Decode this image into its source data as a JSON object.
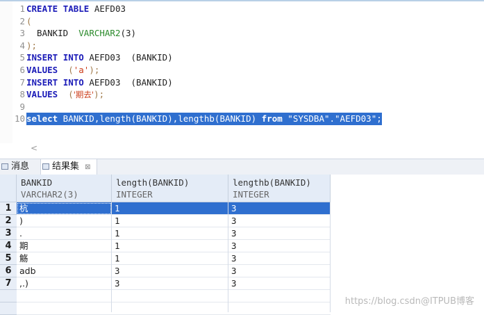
{
  "editor": {
    "lines": [
      {
        "n": "1",
        "tokens": [
          {
            "t": "CREATE",
            "c": "kw"
          },
          {
            "t": " ",
            "c": "id"
          },
          {
            "t": "TABLE",
            "c": "kw"
          },
          {
            "t": " AEFD03",
            "c": "id"
          }
        ]
      },
      {
        "n": "2",
        "tokens": [
          {
            "t": "(",
            "c": "pun"
          }
        ]
      },
      {
        "n": "3",
        "tokens": [
          {
            "t": "  BANKID  ",
            "c": "id"
          },
          {
            "t": "VARCHAR2",
            "c": "ty"
          },
          {
            "t": "(3)",
            "c": "id"
          }
        ]
      },
      {
        "n": "4",
        "tokens": [
          {
            "t": ");",
            "c": "pun"
          }
        ]
      },
      {
        "n": "5",
        "tokens": [
          {
            "t": "INSERT",
            "c": "kw"
          },
          {
            "t": " ",
            "c": "id"
          },
          {
            "t": "INTO",
            "c": "kw"
          },
          {
            "t": " AEFD03  (BANKID)",
            "c": "id"
          }
        ]
      },
      {
        "n": "6",
        "tokens": [
          {
            "t": "VALUES",
            "c": "kw"
          },
          {
            "t": "  (",
            "c": "pun"
          },
          {
            "t": "'a'",
            "c": "str"
          },
          {
            "t": ");",
            "c": "pun"
          }
        ]
      },
      {
        "n": "7",
        "tokens": [
          {
            "t": "INSERT",
            "c": "kw"
          },
          {
            "t": " ",
            "c": "id"
          },
          {
            "t": "INTO",
            "c": "kw"
          },
          {
            "t": " AEFD03  (BANKID)",
            "c": "id"
          }
        ]
      },
      {
        "n": "8",
        "tokens": [
          {
            "t": "VALUES",
            "c": "kw"
          },
          {
            "t": "  (",
            "c": "pun"
          },
          {
            "t": "'期去'",
            "c": "str-cn"
          },
          {
            "t": ");",
            "c": "pun"
          }
        ]
      },
      {
        "n": "9",
        "tokens": []
      },
      {
        "n": "10",
        "selected": true,
        "tokens": [
          {
            "t": "select",
            "c": "kw"
          },
          {
            "t": " BANKID,length(BANKID),lengthb(BANKID) ",
            "c": "id"
          },
          {
            "t": "from",
            "c": "kw"
          },
          {
            "t": " \"SYSDBA\".\"AEFD03\";",
            "c": "id"
          }
        ]
      }
    ],
    "scroll_hint": "<"
  },
  "tabs": {
    "messages_label": "消息",
    "results_label": "结果集",
    "close_glyph": "⊠"
  },
  "grid": {
    "columns": [
      {
        "name": "BANKID",
        "type": "VARCHAR2(3)"
      },
      {
        "name": "length(BANKID)",
        "type": "INTEGER"
      },
      {
        "name": "lengthb(BANKID)",
        "type": "INTEGER"
      }
    ],
    "rows": [
      {
        "num": "1",
        "cells": [
          "杭",
          "1",
          "3"
        ],
        "selected": true
      },
      {
        "num": "2",
        "cells": [
          ")",
          "1",
          "3"
        ]
      },
      {
        "num": "3",
        "cells": [
          ".",
          "1",
          "3"
        ]
      },
      {
        "num": "4",
        "cells": [
          "期",
          "1",
          "3"
        ]
      },
      {
        "num": "5",
        "cells": [
          "觞",
          "1",
          "3"
        ]
      },
      {
        "num": "6",
        "cells": [
          "adb",
          "3",
          "3"
        ]
      },
      {
        "num": "7",
        "cells": [
          ",.)",
          "3",
          "3"
        ]
      }
    ]
  },
  "watermark": "https://blog.csdn@ITPUB博客"
}
